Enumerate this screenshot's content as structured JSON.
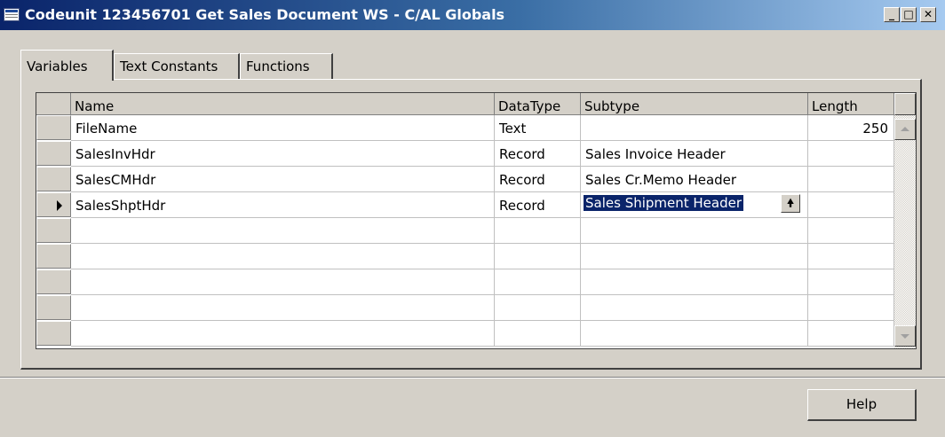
{
  "window": {
    "title": "Codeunit 123456701 Get Sales Document WS - C/AL Globals",
    "icon": "table-window-icon",
    "controls": {
      "minimize": "_",
      "maximize": "□",
      "close": "✕"
    }
  },
  "tabs": [
    {
      "label": "Variables",
      "active": true
    },
    {
      "label": "Text Constants",
      "active": false
    },
    {
      "label": "Functions",
      "active": false
    }
  ],
  "grid": {
    "columns": [
      "Name",
      "DataType",
      "Subtype",
      "Length"
    ],
    "rows": [
      {
        "name": "FileName",
        "datatype": "Text",
        "subtype": "",
        "length": "250",
        "current": false
      },
      {
        "name": "SalesInvHdr",
        "datatype": "Record",
        "subtype": "Sales Invoice Header",
        "length": "",
        "current": false
      },
      {
        "name": "SalesCMHdr",
        "datatype": "Record",
        "subtype": "Sales Cr.Memo Header",
        "length": "",
        "current": false
      },
      {
        "name": "SalesShptHdr",
        "datatype": "Record",
        "subtype": "Sales Shipment Header",
        "length": "",
        "current": true
      },
      {
        "name": "",
        "datatype": "",
        "subtype": "",
        "length": "",
        "current": false
      },
      {
        "name": "",
        "datatype": "",
        "subtype": "",
        "length": "",
        "current": false
      },
      {
        "name": "",
        "datatype": "",
        "subtype": "",
        "length": "",
        "current": false
      },
      {
        "name": "",
        "datatype": "",
        "subtype": "",
        "length": "",
        "current": false
      },
      {
        "name": "",
        "datatype": "",
        "subtype": "",
        "length": "",
        "current": false
      }
    ],
    "lookup_glyph": "🠝"
  },
  "footer": {
    "help_label": "Help"
  },
  "colors": {
    "selection": "#0a246a",
    "face": "#d4d0c8",
    "title_start": "#0a246a",
    "title_end": "#a6caf0"
  }
}
